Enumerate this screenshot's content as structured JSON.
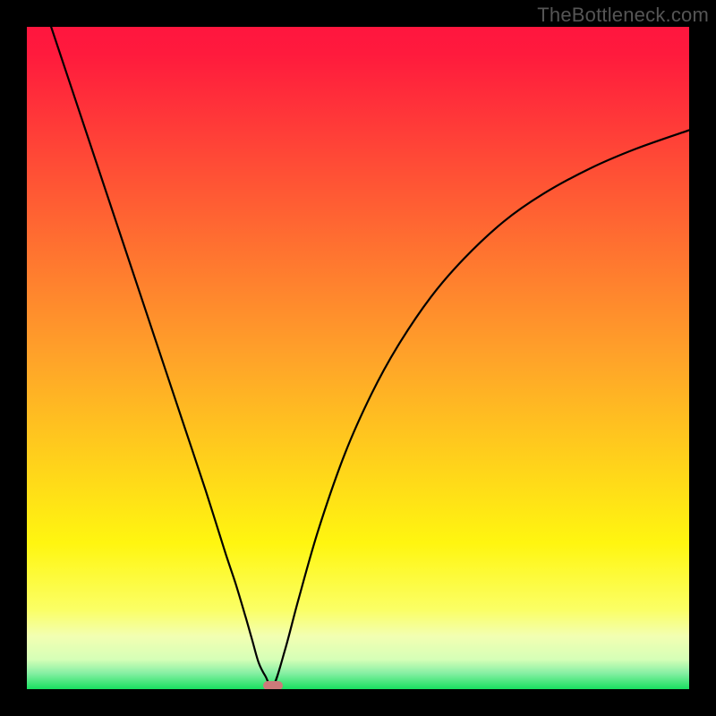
{
  "watermark": {
    "text": "TheBottleneck.com"
  },
  "chart_data": {
    "type": "line",
    "title": "",
    "xlabel": "",
    "ylabel": "",
    "xlim": [
      0,
      1
    ],
    "ylim": [
      0,
      1
    ],
    "background_gradient": {
      "stops": [
        {
          "offset": 0.0,
          "color": "#ff163e"
        },
        {
          "offset": 0.04,
          "color": "#ff1a3d"
        },
        {
          "offset": 0.5,
          "color": "#ffa329"
        },
        {
          "offset": 0.78,
          "color": "#fff610"
        },
        {
          "offset": 0.88,
          "color": "#fbff65"
        },
        {
          "offset": 0.92,
          "color": "#f2ffb2"
        },
        {
          "offset": 0.955,
          "color": "#d6ffb7"
        },
        {
          "offset": 0.975,
          "color": "#8af0a5"
        },
        {
          "offset": 1.0,
          "color": "#18e060"
        }
      ]
    },
    "series": [
      {
        "name": "bottleneck-curve",
        "color": "#000000",
        "width": 2.2,
        "x": [
          0.03,
          0.06,
          0.09,
          0.12,
          0.15,
          0.18,
          0.21,
          0.24,
          0.27,
          0.3,
          0.315,
          0.33,
          0.34,
          0.35,
          0.36,
          0.372,
          0.39,
          0.41,
          0.44,
          0.48,
          0.52,
          0.56,
          0.61,
          0.66,
          0.72,
          0.78,
          0.85,
          0.92,
          1.0
        ],
        "y": [
          1.02,
          0.93,
          0.84,
          0.75,
          0.66,
          0.57,
          0.48,
          0.39,
          0.3,
          0.205,
          0.16,
          0.11,
          0.075,
          0.04,
          0.02,
          0.005,
          0.06,
          0.135,
          0.24,
          0.355,
          0.445,
          0.518,
          0.592,
          0.65,
          0.706,
          0.748,
          0.786,
          0.816,
          0.844
        ]
      }
    ],
    "markers": [
      {
        "name": "minimum-marker",
        "x": 0.372,
        "y": 0.006,
        "color": "#cd7a7a"
      }
    ]
  }
}
